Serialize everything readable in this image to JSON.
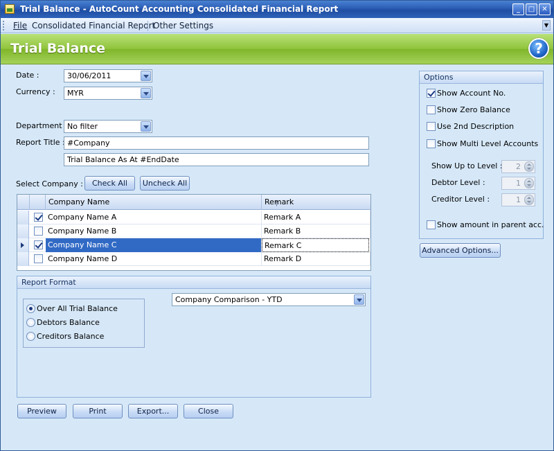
{
  "window": {
    "title": "Trial Balance - AutoCount Accounting Consolidated Financial Report"
  },
  "menu": {
    "file": "File",
    "consolidated": "Consolidated Financial Report",
    "other": "Other Settings"
  },
  "header": {
    "title": "Trial Balance"
  },
  "form": {
    "date_label": "Date :",
    "date_value": "30/06/2011",
    "currency_label": "Currency :",
    "currency_value": "MYR",
    "department_label": "Department :",
    "department_value": "No filter",
    "report_title_label": "Report Title :",
    "report_title_1": "#Company",
    "report_title_2": "Trial Balance As At #EndDate",
    "select_company_label": "Select Company :",
    "check_all": "Check All",
    "uncheck_all": "Uncheck All"
  },
  "grid": {
    "columns": [
      "Company Name",
      "Remark"
    ],
    "rows": [
      {
        "checked": true,
        "name": "Company Name A",
        "remark": "Remark A",
        "selected": false
      },
      {
        "checked": false,
        "name": "Company Name B",
        "remark": "Remark B",
        "selected": false
      },
      {
        "checked": true,
        "name": "Company Name C",
        "remark": "Remark C",
        "selected": true
      },
      {
        "checked": false,
        "name": "Company Name D",
        "remark": "Remark D",
        "selected": false
      }
    ]
  },
  "report_format": {
    "title": "Report Format",
    "options": [
      "Over All Trial Balance",
      "Debtors Balance",
      "Creditors Balance"
    ],
    "selected_index": 0,
    "comparison_value": "Company Comparison - YTD"
  },
  "options": {
    "title": "Options",
    "show_account_no": "Show Account No.",
    "show_zero_balance": "Show Zero Balance",
    "use_2nd_description": "Use 2nd Description",
    "show_multi_level": "Show Multi Level Accounts",
    "show_up_to_level_label": "Show Up to Level :",
    "show_up_to_level_value": "2",
    "debtor_level_label": "Debtor Level :",
    "debtor_level_value": "1",
    "creditor_level_label": "Creditor Level :",
    "creditor_level_value": "1",
    "show_amount_parent": "Show amount in parent acc.",
    "advanced": "Advanced Options..."
  },
  "actions": {
    "preview": "Preview",
    "print": "Print",
    "export": "Export...",
    "close": "Close"
  }
}
